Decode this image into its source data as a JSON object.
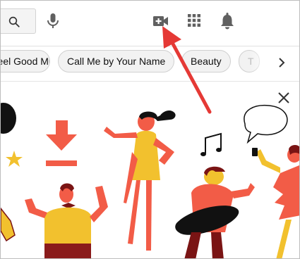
{
  "header": {
    "search_icon": "search-icon",
    "mic_icon": "microphone-icon",
    "create_icon": "video-create-icon",
    "apps_icon": "apps-grid-icon",
    "notifications_icon": "bell-icon"
  },
  "chips": [
    {
      "label": "Feel Good Music"
    },
    {
      "label": "Call Me by Your Name"
    },
    {
      "label": "Beauty"
    },
    {
      "label": "T"
    }
  ],
  "chips_next_icon": "chevron-right-icon",
  "banner": {
    "close_icon": "close-icon"
  },
  "colors": {
    "annotation_arrow": "#e53935",
    "icon_gray": "#606060",
    "illustration_red": "#f25c47",
    "illustration_yellow": "#f2c12e",
    "illustration_dark": "#7a1414"
  }
}
